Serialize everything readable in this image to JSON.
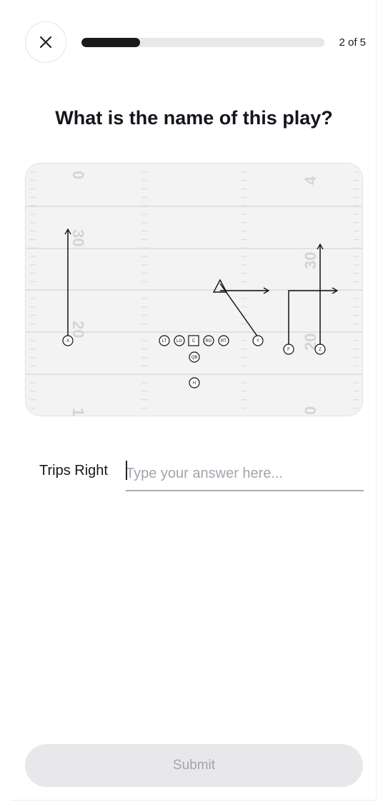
{
  "header": {
    "close_icon": "close-icon",
    "progress": {
      "current": 2,
      "total": 5,
      "fill_fraction": 0.24,
      "label": "2 of 5"
    }
  },
  "question": {
    "text": "What is the name of this play?"
  },
  "play_diagram": {
    "yard_numbers": {
      "top_left": "0",
      "top_right": "4",
      "mid_left_upper": "30",
      "mid_right_upper": "30",
      "mid_left_lower": "20",
      "mid_right_lower": "20",
      "bottom_left": "1",
      "bottom_right": "0"
    },
    "players": {
      "x": "X",
      "lt": "LT",
      "lg": "LG",
      "c": "C",
      "rg": "RG",
      "rt": "RT",
      "y": "Y",
      "qb": "QB",
      "h": "H",
      "f": "F",
      "z": "Z"
    },
    "colors": {
      "field": "#f3f3f4",
      "line": "#cfcfd3",
      "route": "#111111"
    }
  },
  "answer": {
    "prefix": "Trips Right",
    "placeholder": "Type your answer here...",
    "value": ""
  },
  "submit": {
    "label": "Submit",
    "enabled": false
  }
}
